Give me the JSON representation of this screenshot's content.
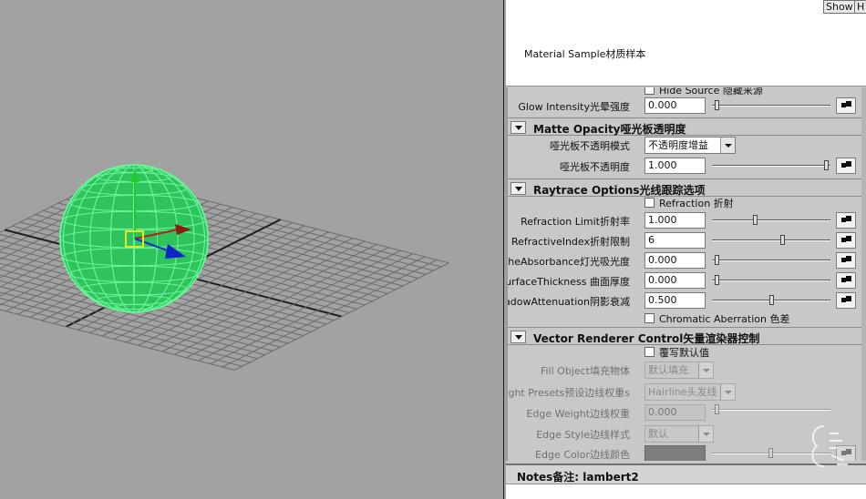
{
  "header": {
    "show_button": "Show",
    "extra_button": "H",
    "material_sample": "Material Sample材质样本"
  },
  "partial_top_label": "Hide Source 隐藏来源",
  "glow": {
    "label": "Glow Intensity光晕强度",
    "value": "0.000",
    "slider_fraction": 0.0
  },
  "matte": {
    "title": "Matte Opacity哑光板透明度",
    "mode_label": "哑光板不透明模式",
    "mode_value": "不透明度增益",
    "opacity_label": "哑光板不透明度",
    "opacity_value": "1.000",
    "opacity_fraction": 1.0
  },
  "raytrace": {
    "title": "Raytrace Options光线跟踪选项",
    "refraction_check": "Refraction 折射",
    "rows": [
      {
        "label": "Refraction Limit折射率",
        "value": "1.000",
        "fraction": 0.35
      },
      {
        "label": "RefractiveIndex折射限制",
        "value": "6",
        "fraction": 0.6
      },
      {
        "label": "gheAbsorbance灯光吸光度",
        "value": "0.000",
        "fraction": 0.0
      },
      {
        "label": "SurfaceThickness 曲面厚度",
        "value": "0.000",
        "fraction": 0.0
      },
      {
        "label": "nadowAttenuation阴影衰减",
        "value": "0.500",
        "fraction": 0.5
      }
    ],
    "chromatic_check": "Chromatic Aberration 色差"
  },
  "vector": {
    "title": "Vector Renderer Control矢量渲染器控制",
    "override_check": "覆写默认值",
    "fill_label": "Fill Object填充物体",
    "fill_value": "默认填充",
    "presets_label": "ight Presets预设边线权重s",
    "presets_value": "Hairline头发线",
    "edge_weight_label": "Edge Weight边线权重",
    "edge_weight_value": "0.000",
    "edge_style_label": "Edge Style边线样式",
    "edge_style_value": "默认",
    "edge_color_label": "Edge Color边线颜色"
  },
  "notes": {
    "label": "Notes备注: lambert2"
  },
  "colors": {
    "sphere_wire": "#6bf59a",
    "sphere_fill": "#2fc35d",
    "grid": "#6a6a6a",
    "viewport_bg": "#a2a2a2",
    "panel_bg": "#c8c8c8"
  },
  "icons": {
    "section_toggle": "triangle-down-icon",
    "map_button": "checker-map-icon",
    "combo_arrow": "chevron-down-icon"
  }
}
